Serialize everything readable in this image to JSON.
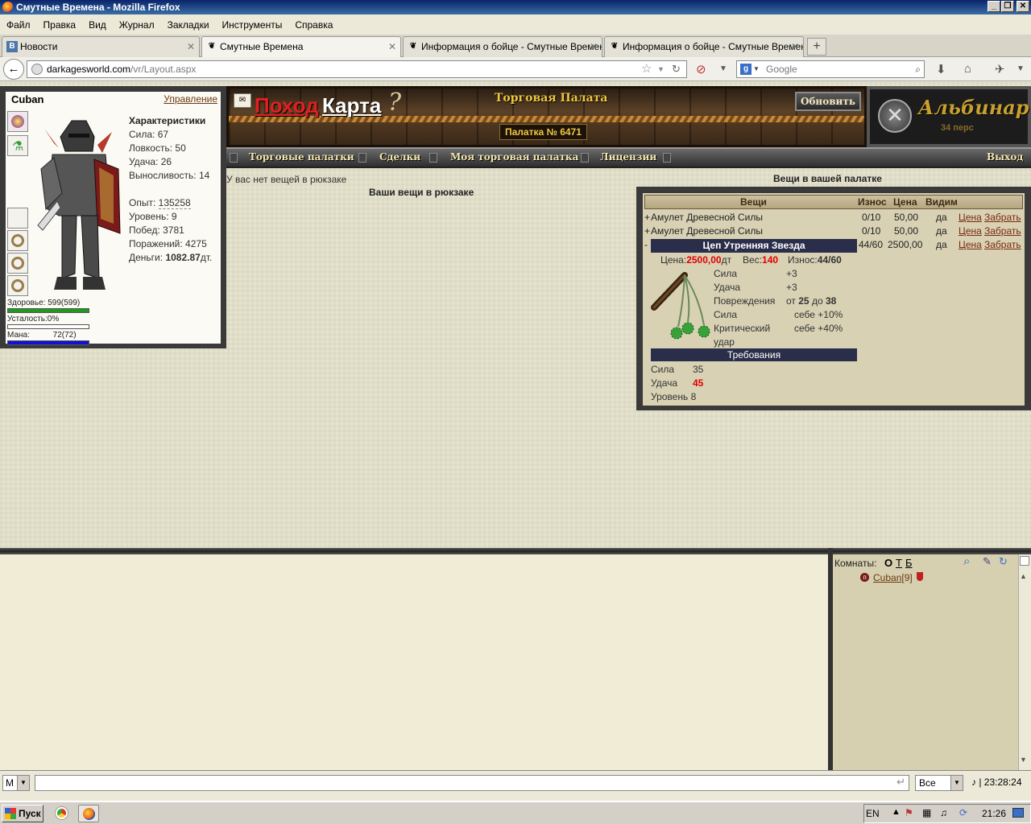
{
  "window": {
    "title": "Смутные Времена - Mozilla Firefox",
    "min": "_",
    "restore": "❐",
    "close": "✕"
  },
  "menu": [
    "Файл",
    "Правка",
    "Вид",
    "Журнал",
    "Закладки",
    "Инструменты",
    "Справка"
  ],
  "tabs": [
    {
      "label": "Новости",
      "icon": "В"
    },
    {
      "label": "Смутные Времена",
      "icon": "❦"
    },
    {
      "label": "Информация о бойце - Смутные Времена",
      "icon": "❦"
    },
    {
      "label": "Информация о бойце - Смутные Времена",
      "icon": "❦"
    }
  ],
  "address": {
    "host": "darkagesworld.com",
    "path": "/vr/Layout.aspx"
  },
  "search": {
    "engine_icon": "g",
    "placeholder": "Google"
  },
  "character": {
    "name": "Cuban",
    "manage": "Управление",
    "stats_title": "Характеристики",
    "strength": "Сила: 67",
    "agility": "Ловкость: 50",
    "luck": "Удача: 26",
    "endurance": "Выносливость: 14",
    "exp_label": "Опыт:",
    "exp": "135258",
    "level": "Уровень: 9",
    "wins": "Побед: 3781",
    "losses": "Поражений: 4275",
    "money_label": "Деньги:",
    "money": "1082.87",
    "money_unit": "дт.",
    "health_label": "Здоровье:",
    "health": "599(599)",
    "fatigue_label": "Усталость:0%",
    "mana_label": "Мана:",
    "mana": "72(72)",
    "colors": {
      "health": "#1e9a1e",
      "mana": "#1010d8"
    }
  },
  "header": {
    "hike": "Поход",
    "map": "Карта",
    "help": "?",
    "hall": "Торговая Палата",
    "tent": "Палатка № 6471",
    "refresh": "Обновить"
  },
  "realm": {
    "name": "Альбинар",
    "count": "34 перс"
  },
  "nav": [
    "Торговые палатки",
    "Сделки",
    "Моя торговая палатка",
    "Лицензии"
  ],
  "exit": "Выход",
  "backpack": {
    "empty": "У вас нет вещей в рюкзаке",
    "title": "Ваши вещи в рюкзаке"
  },
  "tent_items": {
    "title": "Вещи в вашей палатке",
    "headers": [
      "Вещи",
      "Износ",
      "Цена",
      "Видим"
    ],
    "rows": [
      {
        "mark": "+",
        "name": "Амулет Древесной Силы",
        "wear": "0/10",
        "price": "50,00",
        "visible": "да",
        "act1": "Цена",
        "act2": "Забрать"
      },
      {
        "mark": "+",
        "name": "Амулет Древесной Силы",
        "wear": "0/10",
        "price": "50,00",
        "visible": "да",
        "act1": "Цена",
        "act2": "Забрать"
      },
      {
        "mark": "-",
        "name": "Цеп Утренняя Звезда",
        "wear": "44/60",
        "price": "2500,00",
        "visible": "да",
        "act1": "Цена",
        "act2": "Забрать"
      }
    ],
    "detail": {
      "price_label": "Цена:",
      "price": "2500,00",
      "price_unit": "дт",
      "weight_label": "Вес:",
      "weight": "140",
      "wear_label": "Износ:",
      "wear": "44/60",
      "props": [
        {
          "k": "Сила",
          "v": "+3"
        },
        {
          "k": "Удача",
          "v": "+3"
        },
        {
          "k": "Повреждения",
          "v_pre": "от ",
          "v_a": "25",
          "v_mid": " до ",
          "v_b": "38"
        },
        {
          "k": "Сила",
          "v": "себе +10%"
        },
        {
          "k": "Критический",
          "v": "себе +40%"
        },
        {
          "k": "удар",
          "v": ""
        }
      ],
      "req_title": "Требования",
      "reqs": [
        {
          "k": "Сила",
          "v": "35"
        },
        {
          "k": "Удача",
          "v": "45"
        },
        {
          "k": "Уровень",
          "v": "8"
        }
      ]
    }
  },
  "rooms": {
    "label": "Комнаты:",
    "o": "О",
    "t": "Т",
    "b": "Б",
    "user": "Cuban",
    "user_level": "[9]"
  },
  "chat": {
    "mode": "М",
    "filter": "Все",
    "time": "23:28:24"
  },
  "taskbar": {
    "start": "Пуск",
    "lang": "EN",
    "clock": "21:26"
  }
}
